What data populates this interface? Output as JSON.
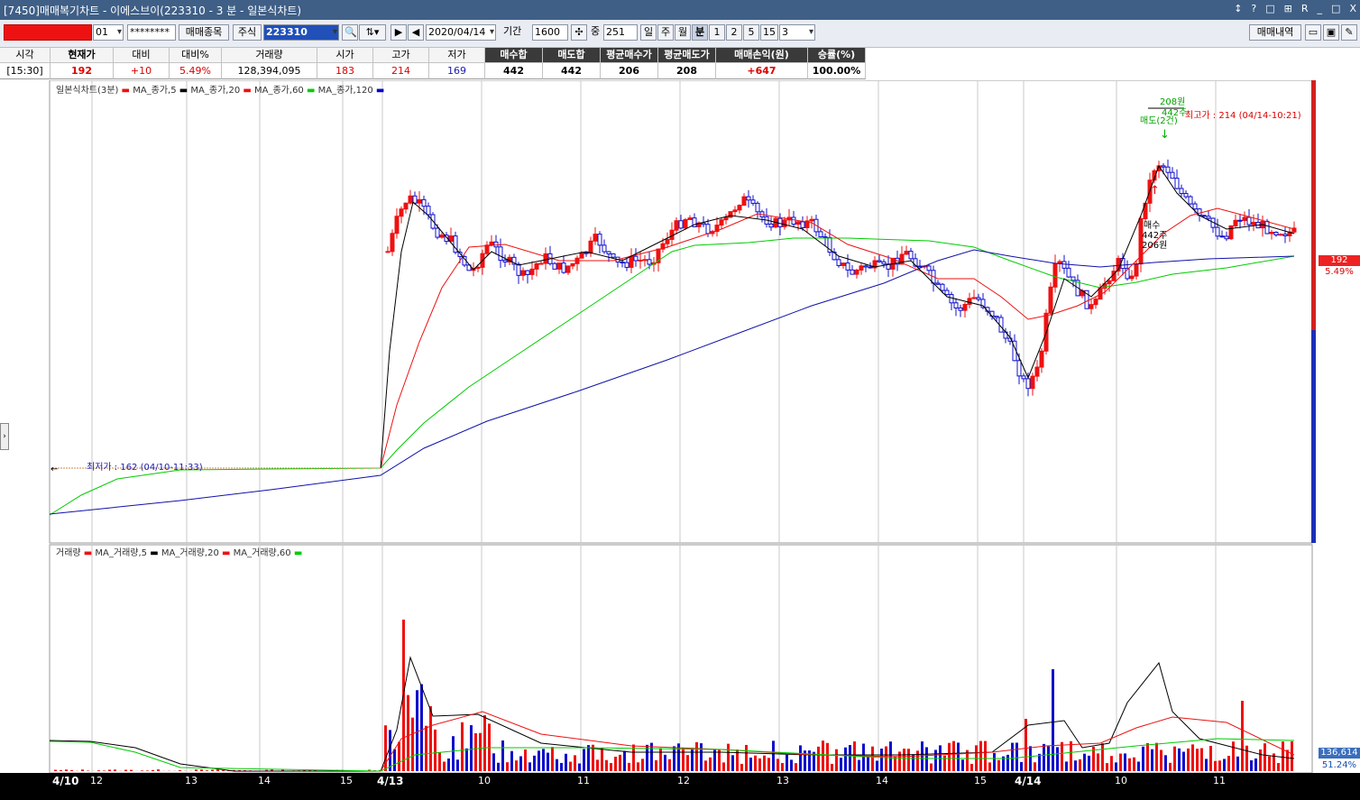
{
  "window": {
    "title": "[7450]매매복기차트 - 이에스브이(223310 - 3 분 - 일본식차트)",
    "controls": [
      "↕",
      "?",
      "□",
      "⊞",
      "R",
      "_",
      "□",
      "X"
    ]
  },
  "toolbar": {
    "account_suffix": "01",
    "password": "********",
    "trade_items_label": "매매종목",
    "market_label": "주식",
    "code": "223310",
    "date": "2020/04/14",
    "period_label": "기간",
    "period_value": "1600",
    "middle_label": "중",
    "count_value": "251",
    "period_buttons": [
      "일",
      "주",
      "월",
      "분",
      "1",
      "2",
      "5",
      "15"
    ],
    "minute_select": "3",
    "trade_history_label": "매매내역"
  },
  "info": {
    "headers": [
      "시각",
      "현재가",
      "대비",
      "대비%",
      "거래량",
      "시가",
      "고가",
      "저가",
      "매수합",
      "매도합",
      "평균매수가",
      "평균매도가",
      "매매손익(원)",
      "승률(%)"
    ],
    "values": [
      "[15:30]",
      "192",
      "+10",
      "5.49%",
      "128,394,095",
      "183",
      "214",
      "169",
      "442",
      "442",
      "206",
      "208",
      "+647",
      "100.00%"
    ]
  },
  "chart": {
    "legend": [
      {
        "name": "일본식차트(3분)",
        "color": "#ee1111"
      },
      {
        "name": "MA_종가,5",
        "color": "#000000"
      },
      {
        "name": "MA_종가,20",
        "color": "#ee1111"
      },
      {
        "name": "MA_종가,60",
        "color": "#00cc00"
      },
      {
        "name": "MA_종가,120",
        "color": "#0000cc"
      }
    ],
    "high_annotation": "최고가 : 214 (04/14-10:21)",
    "low_annotation": "최저가 : 162 (04/10-11:33)",
    "sell_annotation": [
      "208원",
      "442주",
      "매도(2건)"
    ],
    "buy_annotation": [
      "매수",
      "442주",
      "206원"
    ],
    "current_price": "192",
    "current_pct": "5.49%"
  },
  "volume": {
    "legend": [
      {
        "name": "거래량",
        "color": "#ee1111"
      },
      {
        "name": "MA_거래량,5",
        "color": "#000000"
      },
      {
        "name": "MA_거래량,20",
        "color": "#ee1111"
      },
      {
        "name": "MA_거래량,60",
        "color": "#00cc00"
      }
    ],
    "current_volume": "136,614",
    "current_pct": "51.24%"
  },
  "axis": {
    "labels": [
      {
        "t": "4/10",
        "bold": true
      },
      {
        "t": "12",
        "bold": false
      },
      {
        "t": "13",
        "bold": false
      },
      {
        "t": "14",
        "bold": false
      },
      {
        "t": "15",
        "bold": false
      },
      {
        "t": "4/13",
        "bold": true
      },
      {
        "t": "10",
        "bold": false
      },
      {
        "t": "11",
        "bold": false
      },
      {
        "t": "12",
        "bold": false
      },
      {
        "t": "13",
        "bold": false
      },
      {
        "t": "14",
        "bold": false
      },
      {
        "t": "15",
        "bold": false
      },
      {
        "t": "4/14",
        "bold": true
      },
      {
        "t": "10",
        "bold": false
      },
      {
        "t": "11",
        "bold": false
      }
    ]
  },
  "colors": {
    "up": "#ee1111",
    "down": "#1010cc",
    "titlebar": "#3f5f86"
  }
}
